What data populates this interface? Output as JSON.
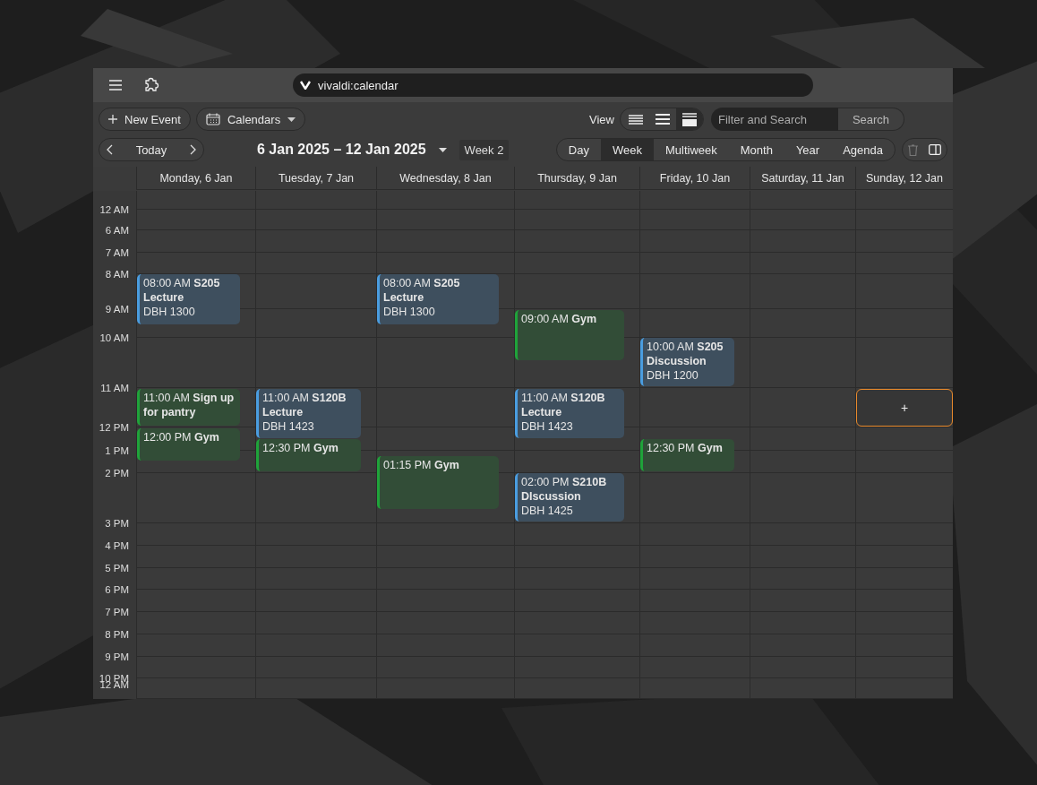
{
  "address_bar": {
    "url": "vivaldi:calendar"
  },
  "toolbar": {
    "new_event": "New Event",
    "calendars": "Calendars",
    "view_label": "View",
    "density_options": [
      {
        "selected": false
      },
      {
        "selected": false
      },
      {
        "selected": true
      }
    ],
    "search": {
      "placeholder": "Filter and Search",
      "button": "Search"
    },
    "today": "Today",
    "date_range": "6 Jan 2025 – 12 Jan 2025",
    "week_badge": "Week 2",
    "view_tabs": [
      {
        "label": "Day",
        "selected": false
      },
      {
        "label": "Week",
        "selected": true
      },
      {
        "label": "Multiweek",
        "selected": false
      },
      {
        "label": "Month",
        "selected": false
      },
      {
        "label": "Year",
        "selected": false
      },
      {
        "label": "Agenda",
        "selected": false
      }
    ]
  },
  "calendar": {
    "hours": [
      "12 AM",
      "6 AM",
      "7 AM",
      "8 AM",
      "9 AM",
      "10 AM",
      "11 AM",
      "12 PM",
      "1 PM",
      "2 PM",
      "3 PM",
      "4 PM",
      "5 PM",
      "6 PM",
      "7 PM",
      "8 PM",
      "9 PM",
      "10 PM",
      "12 AM"
    ],
    "days": [
      {
        "label": "Monday, 6 Jan",
        "events": [
          {
            "kind": "event",
            "text": "08:00 AM **S205 Lecture**",
            "location": "DBH 1300",
            "color": "#4a9de0"
          },
          {
            "kind": "event",
            "text": "11:00 AM **Sign up for pantry**",
            "color": "#1fa33a"
          },
          {
            "kind": "event",
            "text": "12:00 PM **Gym**",
            "color": "#1fa33a"
          }
        ]
      },
      {
        "label": "Tuesday, 7 Jan",
        "events": [
          {
            "kind": "event",
            "text": "11:00 AM **S120B Lecture**",
            "location": "DBH 1423",
            "color": "#4a9de0"
          },
          {
            "kind": "event",
            "text": "12:30 PM **Gym**",
            "color": "#1fa33a"
          }
        ]
      },
      {
        "label": "Wednesday, 8 Jan",
        "events": [
          {
            "kind": "event",
            "text": "08:00 AM **S205 Lecture**",
            "location": "DBH 1300",
            "color": "#4a9de0"
          },
          {
            "kind": "event",
            "text": "01:15 PM **Gym**",
            "color": "#1fa33a"
          }
        ]
      },
      {
        "label": "Thursday, 9 Jan",
        "events": [
          {
            "kind": "event",
            "text": "09:00 AM **Gym**",
            "color": "#1fa33a"
          },
          {
            "kind": "event",
            "text": "11:00 AM **S120B Lecture**",
            "location": "DBH 1423",
            "color": "#4a9de0"
          },
          {
            "kind": "event",
            "text": "02:00 PM **S210B DIscussion**",
            "location": "DBH 1425",
            "color": "#4a9de0"
          }
        ]
      },
      {
        "label": "Friday, 10 Jan",
        "events": [
          {
            "kind": "event",
            "text": "10:00 AM **S205 Discussion**",
            "location": "DBH 1200",
            "color": "#4a9de0"
          },
          {
            "kind": "event",
            "text": "12:30 PM **Gym**",
            "color": "#1fa33a"
          }
        ]
      },
      {
        "label": "Saturday, 11 Jan"
      },
      {
        "label": "Sunday, 12 Jan",
        "events": [
          {
            "kind": "new_slot",
            "text": "+"
          }
        ]
      }
    ]
  }
}
